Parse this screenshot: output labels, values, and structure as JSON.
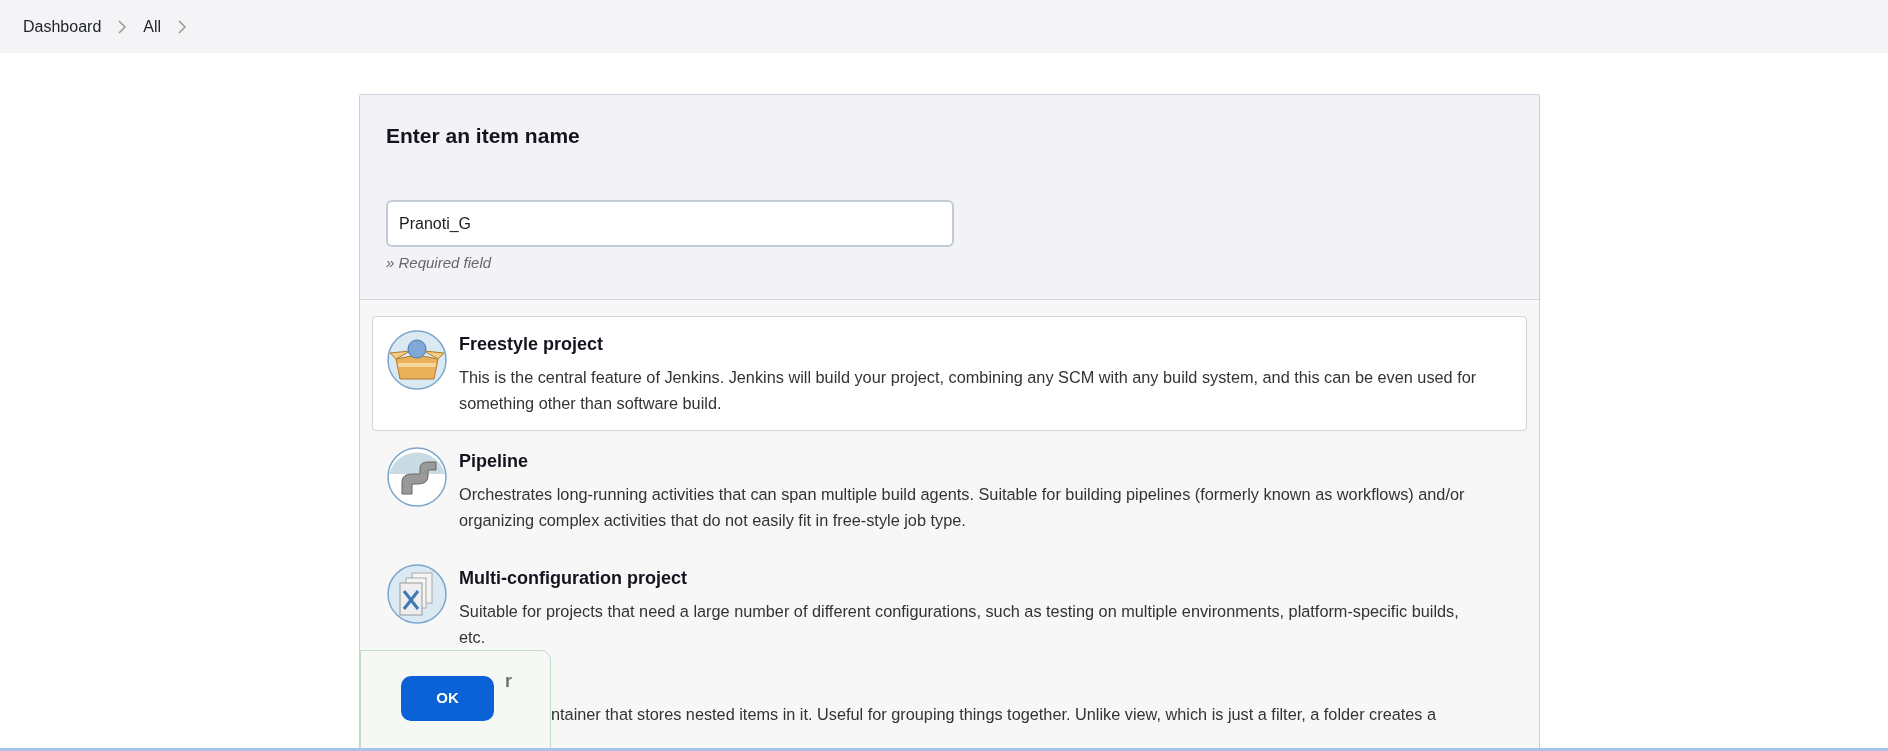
{
  "breadcrumbs": [
    {
      "label": "Dashboard"
    },
    {
      "label": "All"
    }
  ],
  "form": {
    "heading": "Enter an item name",
    "item_name": {
      "value": "Pranoti_G"
    },
    "hint": "» Required field"
  },
  "item_types": [
    {
      "kind": "freestyle",
      "title": "Freestyle project",
      "description": "This is the central feature of Jenkins. Jenkins will build your project, combining any SCM with any build system, and this can be even used for something other than software build.",
      "selected": true
    },
    {
      "kind": "pipeline",
      "title": "Pipeline",
      "description": "Orchestrates long-running activities that can span multiple build agents. Suitable for building pipelines (formerly known as workflows) and/or organizing complex activities that do not easily fit in free-style job type.",
      "selected": false
    },
    {
      "kind": "multiconfig",
      "title": "Multi-configuration project",
      "description": "Suitable for projects that need a large number of different configurations, such as testing on multiple environments, platform-specific builds, etc.",
      "selected": false
    },
    {
      "kind": "folder",
      "title": "r",
      "description": "ntainer that stores nested items in it. Useful for grouping things together. Unlike view, which is just a filter, a folder creates a",
      "selected": false
    }
  ],
  "ok_button": {
    "label": "OK"
  }
}
